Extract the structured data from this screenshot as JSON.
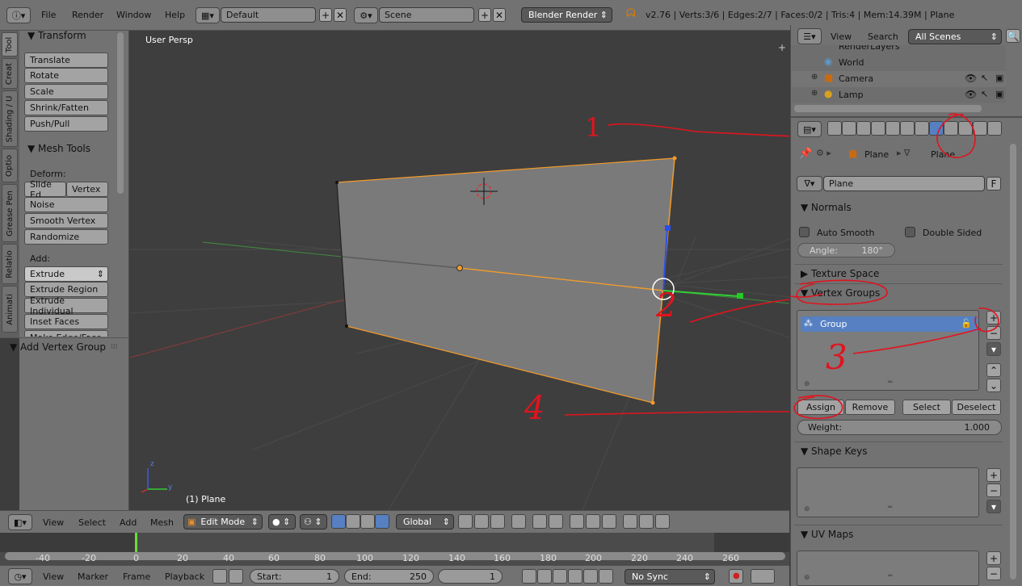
{
  "topbar": {
    "menus": [
      "File",
      "Render",
      "Window",
      "Help"
    ],
    "layout": "Default",
    "scene": "Scene",
    "engine": "Blender Render",
    "status": "v2.76 | Verts:3/6 | Edges:2/7 | Faces:0/2 | Tris:4 | Mem:14.39M | Plane"
  },
  "tabs": [
    "Tool",
    "Creat",
    "Shading / U",
    "Optio",
    "Grease Pen",
    "Relatio",
    "Animati"
  ],
  "toolshelf": {
    "transform_title": "Transform",
    "transform": [
      "Translate",
      "Rotate",
      "Scale",
      "Shrink/Fatten",
      "Push/Pull"
    ],
    "meshtools_title": "Mesh Tools",
    "deform_label": "Deform:",
    "slide_edge": "Slide Ed",
    "vertex": "Vertex",
    "deform": [
      "Noise",
      "Smooth Vertex",
      "Randomize"
    ],
    "add_label": "Add:",
    "extrude": "Extrude",
    "add": [
      "Extrude Region",
      "Extrude Individual",
      "Inset Faces"
    ],
    "cut_item": "Make Edge/Face",
    "operator_title": "Add Vertex Group"
  },
  "viewport": {
    "label": "User Persp",
    "object": "(1) Plane",
    "axis_x": "y",
    "axis_z": "z"
  },
  "outliner": {
    "view": "View",
    "search": "Search",
    "scenes": "All Scenes",
    "items": [
      "RenderLayers",
      "World",
      "Camera",
      "Lamp"
    ]
  },
  "properties": {
    "breadcrumb_obj": "Plane",
    "breadcrumb_mesh": "Plane",
    "mesh_name": "Plane",
    "fake_user": "F",
    "normals_title": "Normals",
    "auto_smooth": "Auto Smooth",
    "double_sided": "Double Sided",
    "angle_label": "Angle:",
    "angle_value": "180°",
    "texture_space": "Texture Space",
    "vertex_groups": "Vertex Groups",
    "group_name": "Group",
    "assign": "Assign",
    "remove": "Remove",
    "select": "Select",
    "deselect": "Deselect",
    "weight_label": "Weight:",
    "weight_value": "1.000",
    "shape_keys": "Shape Keys",
    "uv_maps": "UV Maps"
  },
  "vpheader": {
    "menus": [
      "View",
      "Select",
      "Add",
      "Mesh"
    ],
    "mode": "Edit Mode",
    "orientation": "Global"
  },
  "timeline": {
    "ticks": [
      "-40",
      "-20",
      "0",
      "20",
      "40",
      "60",
      "80",
      "100",
      "120",
      "140",
      "160",
      "180",
      "200",
      "220",
      "240",
      "260"
    ],
    "menus": [
      "View",
      "Marker",
      "Frame",
      "Playback"
    ],
    "start_label": "Start:",
    "start": "1",
    "end_label": "End:",
    "end": "250",
    "current": "1",
    "sync": "No Sync"
  },
  "annotations": [
    "1",
    "2",
    "3",
    "4"
  ],
  "colors": {
    "selected_row": "#5680c2",
    "annotation": "#e0141e",
    "selected_edge": "#f29b2a"
  }
}
